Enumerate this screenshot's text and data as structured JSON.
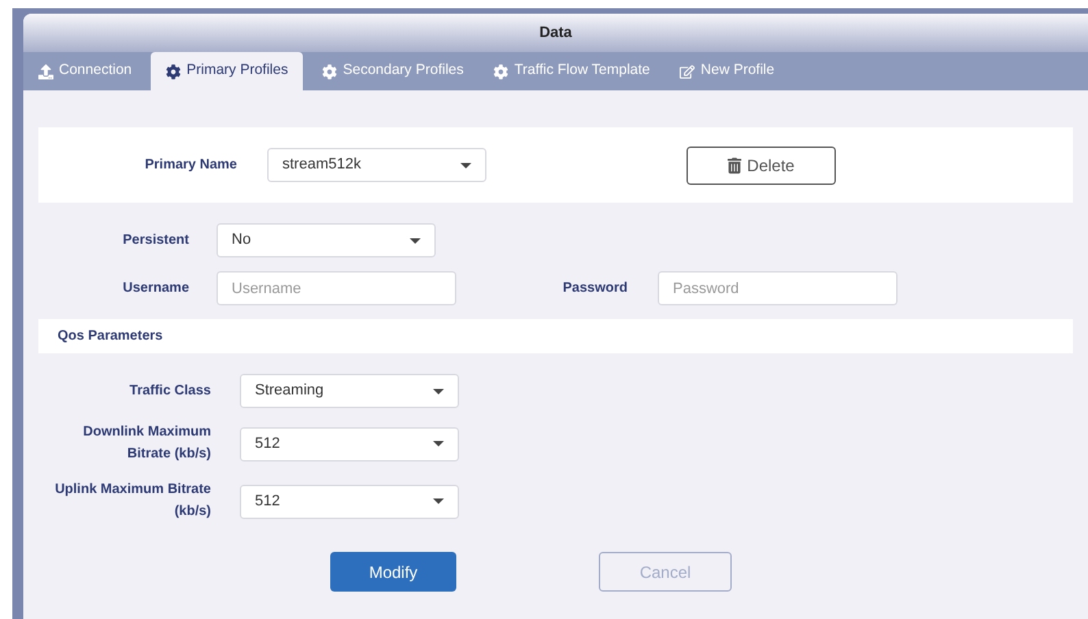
{
  "window": {
    "title": "Data"
  },
  "tabs": [
    {
      "label": "Connection",
      "kind": "upload",
      "selected": false
    },
    {
      "label": "Primary Profiles",
      "kind": "settings",
      "selected": true
    },
    {
      "label": "Secondary Profiles",
      "kind": "settings",
      "selected": false
    },
    {
      "label": "Traffic Flow Template",
      "kind": "settings",
      "selected": false
    },
    {
      "label": "New Profile",
      "kind": "create",
      "selected": false
    }
  ],
  "primary": {
    "label": "Primary Name",
    "value": "stream512k",
    "delete_label": "Delete"
  },
  "persistent": {
    "label": "Persistent",
    "value": "No"
  },
  "username": {
    "label": "Username",
    "placeholder": "Username"
  },
  "password": {
    "label": "Password",
    "placeholder": "Password"
  },
  "qos": {
    "title": "Qos Parameters",
    "fields": [
      {
        "label": "Traffic Class",
        "value": "Streaming"
      },
      {
        "label": "Downlink Maximum Bitrate (kb/s)",
        "value": "512"
      },
      {
        "label": "Uplink Maximum Bitrate (kb/s)",
        "value": "512"
      }
    ]
  },
  "buttons": [
    {
      "label": "Modify",
      "kind": "primary"
    },
    {
      "label": "Cancel",
      "kind": "secondary"
    }
  ]
}
